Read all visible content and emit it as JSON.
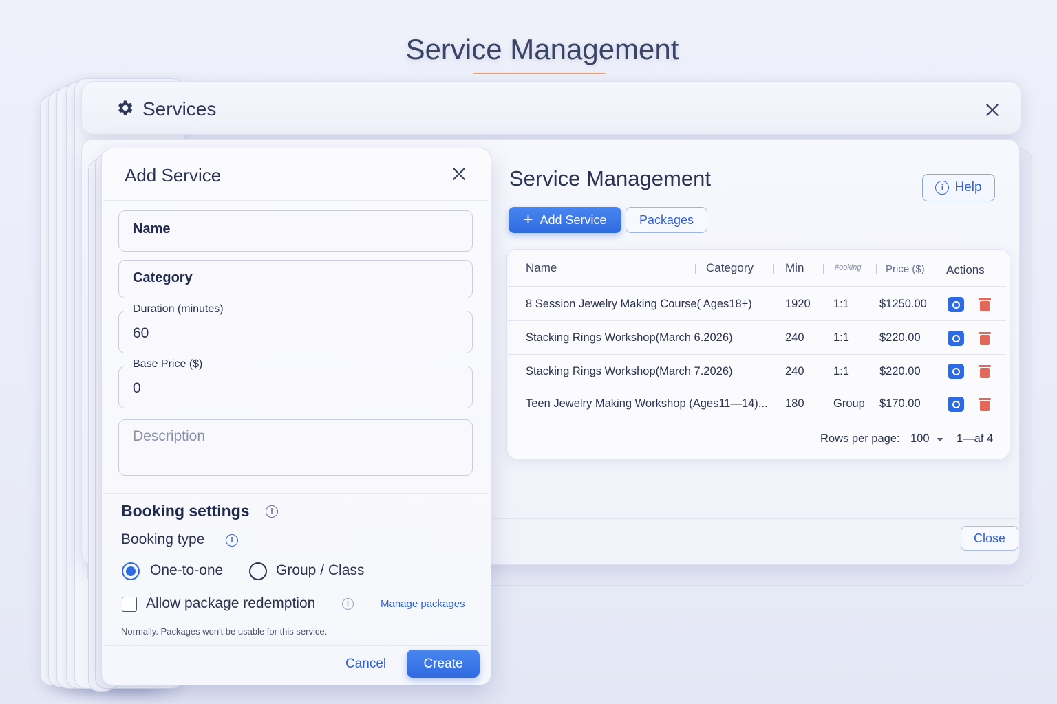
{
  "page": {
    "title": "Service Management"
  },
  "services_window": {
    "title": "Services",
    "icon": "gear-icon"
  },
  "list": {
    "title": "Service Management",
    "help_label": "Help",
    "add_service_label": "Add Service",
    "packages_label": "Packages",
    "columns": [
      "Name",
      "Category",
      "Min",
      "#ooking",
      "Price ($)",
      "Actions"
    ],
    "rows": [
      {
        "name": "8 Session Jewelry Making Course( Ages18+)",
        "category": "",
        "min": "1920",
        "booking": "1:1",
        "price": "$1250.00"
      },
      {
        "name": "Stacking Rings Workshop(March 6.2026)",
        "category": "",
        "min": "240",
        "booking": "1:1",
        "price": "$220.00"
      },
      {
        "name": "Stacking Rings Workshop(March 7.2026)",
        "category": "",
        "min": "240",
        "booking": "1:1",
        "price": "$220.00"
      },
      {
        "name": "Teen Jewelry Making Workshop (Ages11—14)...",
        "category": "",
        "min": "180",
        "booking": "Group",
        "price": "$170.00"
      }
    ],
    "rows_per_page_label": "Rows per page:",
    "rows_per_page_value": "100",
    "range": "1—af 4",
    "close_label": "Close"
  },
  "dialog": {
    "title": "Add Service",
    "name_label": "Name",
    "category_label": "Category",
    "duration_label": "Duration (minutes)",
    "duration_value": "60",
    "price_label": "Base Price ($)",
    "price_value": "0",
    "description_placeholder": "Description",
    "booking_settings_title": "Booking settings",
    "booking_type_label": "Booking type",
    "option_one": "One-to-one",
    "option_group": "Group / Class",
    "selected_option": "One-to-one",
    "allow_package_label": "Allow package redemption",
    "allow_package_checked": false,
    "manage_packages_label": "Manage packages",
    "hint": "Normally. Packages won't be usable for this service.",
    "cancel_label": "Cancel",
    "create_label": "Create"
  },
  "colors": {
    "accent": "#2f6be0",
    "danger": "#e2685a",
    "underline": "#f0a070"
  }
}
